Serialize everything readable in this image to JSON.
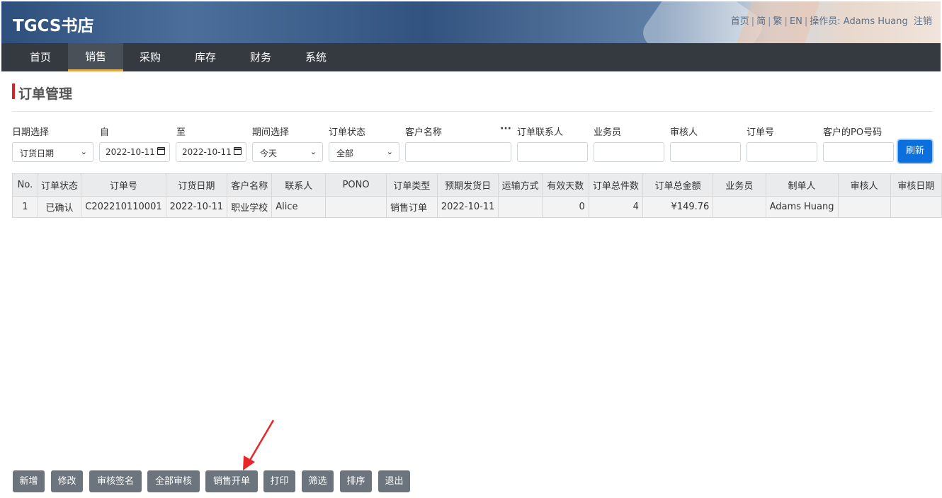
{
  "app": {
    "logo": "TGCS书店"
  },
  "toplinks": {
    "home": "首页",
    "simplified": "简",
    "traditional": "繁",
    "english": "EN",
    "operator_prefix": "操作员:",
    "operator": "Adams Huang",
    "logout": "注销"
  },
  "nav": [
    "首页",
    "销售",
    "采购",
    "库存",
    "财务",
    "系统"
  ],
  "nav_active": "销售",
  "page_title": "订单管理",
  "filters": {
    "date_select": {
      "label": "日期选择",
      "value": "订货日期"
    },
    "from": {
      "label": "自",
      "value": "2022-10-11"
    },
    "to": {
      "label": "至",
      "value": "2022-10-11"
    },
    "period": {
      "label": "期间选择",
      "value": "今天"
    },
    "status": {
      "label": "订单状态",
      "value": "全部"
    },
    "customer": {
      "label": "客户名称",
      "value": ""
    },
    "contact": {
      "label": "订单联系人",
      "value": ""
    },
    "salesman": {
      "label": "业务员",
      "value": ""
    },
    "auditor": {
      "label": "审核人",
      "value": ""
    },
    "order_no": {
      "label": "订单号",
      "value": ""
    },
    "po_no": {
      "label": "客户的PO号码",
      "value": ""
    },
    "ellipsis": "···",
    "refresh": "刷新"
  },
  "table": {
    "headers": [
      "No.",
      "订单状态",
      "订单号",
      "订货日期",
      "客户名称",
      "联系人",
      "PONO",
      "订单类型",
      "预期发货日",
      "运输方式",
      "有效天数",
      "订单总件数",
      "订单总金额",
      "业务员",
      "制单人",
      "审核人",
      "审核日期"
    ],
    "rows": [
      [
        "1",
        "已确认",
        "C202210110001",
        "2022-10-11",
        "职业学校",
        "Alice",
        "",
        "销售订单",
        "2022-10-11",
        "",
        "0",
        "4",
        "¥149.76",
        "",
        "Adams Huang",
        "",
        ""
      ]
    ]
  },
  "buttons": [
    "新增",
    "修改",
    "审核签名",
    "全部审核",
    "销售开单",
    "打印",
    "筛选",
    "排序",
    "退出"
  ],
  "colors": {
    "nav_bg": "#343a40",
    "accent_red": "#d9232a",
    "refresh_blue": "#0b6fde",
    "button_gray": "#6c757d",
    "arrow_red": "#e8262a"
  }
}
